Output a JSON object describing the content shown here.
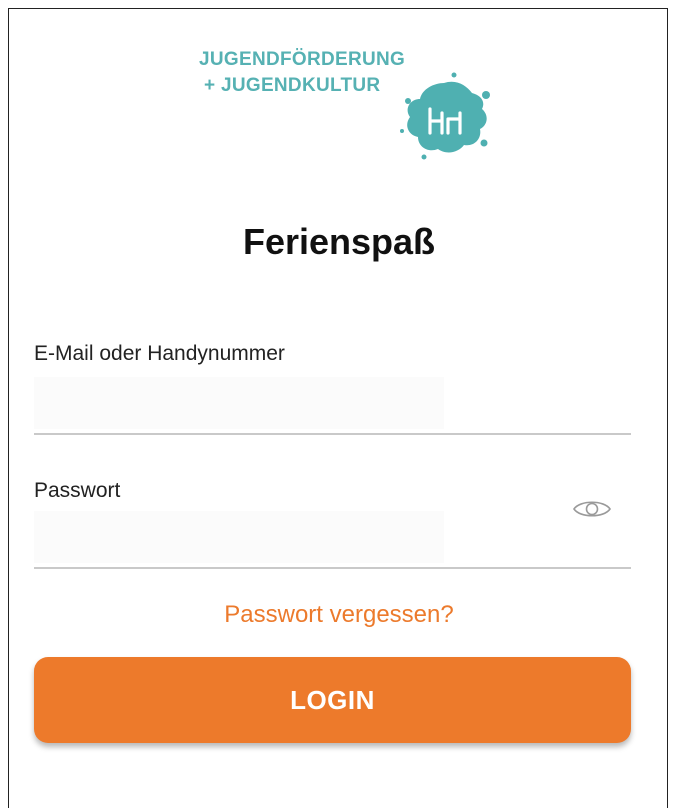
{
  "logo": {
    "line1": "JUGENDFÖRDERUNG",
    "line2": "+ JUGENDKULTUR",
    "color": "#56b1b3",
    "splash_color": "#4fb0b1"
  },
  "title": "Ferienspaß",
  "email_field": {
    "label": "E-Mail oder Handynummer",
    "value": ""
  },
  "password_field": {
    "label": "Passwort",
    "value": "",
    "toggle_icon": "eye-icon"
  },
  "forgot_password": "Passwort vergessen?",
  "login_button": "LOGIN",
  "colors": {
    "accent": "#ed7a2b",
    "link": "#ec7a2c",
    "divider": "#c9c9c9"
  }
}
